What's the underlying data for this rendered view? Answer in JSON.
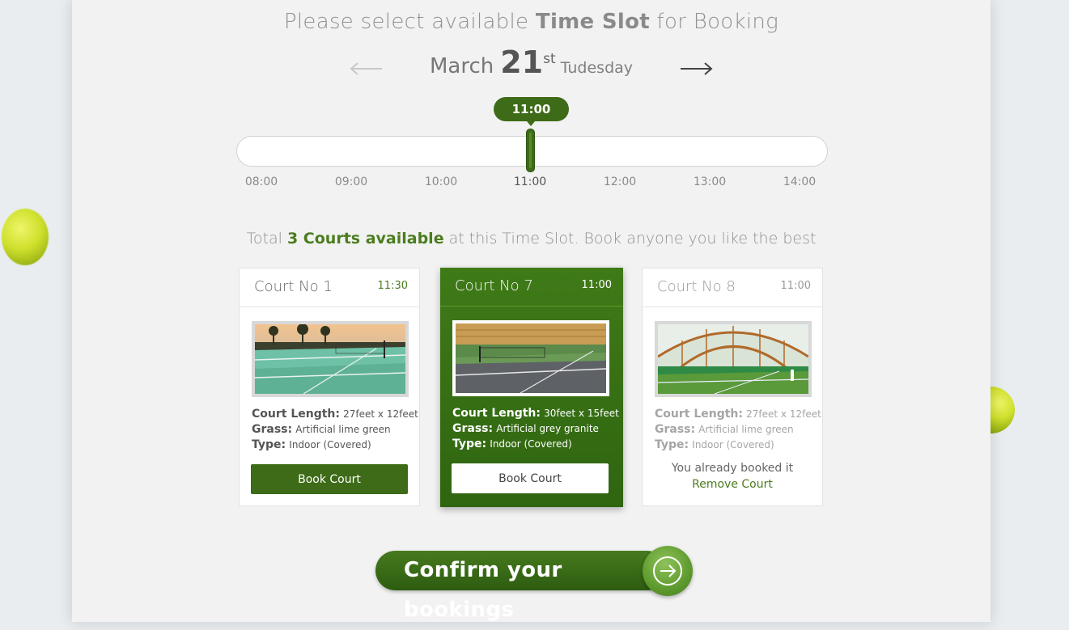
{
  "header": {
    "title_prefix": "Please select available ",
    "title_bold": "Time Slot",
    "title_suffix": " for Booking"
  },
  "date": {
    "month": "March",
    "day": "21",
    "suffix": "st",
    "weekday": "Tudesday"
  },
  "icons": {
    "prev": "arrow-left-icon",
    "next": "arrow-right-icon",
    "confirm": "circle-arrow-right-icon"
  },
  "slider": {
    "selected": "11:00",
    "ticks": [
      "08:00",
      "09:00",
      "10:00",
      "11:00",
      "12:00",
      "13:00",
      "14:00"
    ]
  },
  "availability": {
    "prefix": "Total ",
    "highlight": "3 Courts available",
    "suffix": " at this Time Slot. Book anyone you like the best"
  },
  "courts": [
    {
      "name": "Court No 1",
      "time": "11:30",
      "length_label": "Court Length:",
      "length": "27feet x 12feet",
      "grass_label": "Grass:",
      "grass": "Artificial lime green",
      "type_label": "Type:",
      "type": "Indoor (Covered)",
      "button": "Book Court"
    },
    {
      "name": "Court No 7",
      "time": "11:00",
      "length_label": "Court Length:",
      "length": "30feet x 15feet",
      "grass_label": "Grass:",
      "grass": "Artificial grey granite",
      "type_label": "Type:",
      "type": "Indoor (Covered)",
      "button": "Book Court"
    },
    {
      "name": "Court No 8",
      "time": "11:00",
      "length_label": "Court Length:",
      "length": "27feet x 12feet",
      "grass_label": "Grass:",
      "grass": "Artificial lime green",
      "type_label": "Type:",
      "type": "Indoor (Covered)",
      "booked_note": "You already booked it",
      "remove_label": "Remove Court"
    }
  ],
  "confirm": {
    "label": "Confirm your bookings"
  },
  "colors": {
    "accent": "#3d6b17",
    "highlight_text": "#4b7d1f",
    "background": "#f2f2f2"
  }
}
